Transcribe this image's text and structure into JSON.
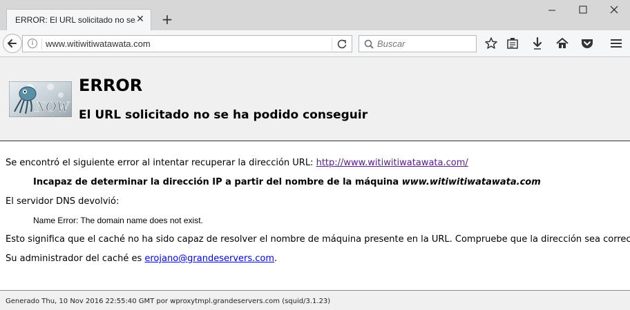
{
  "browser": {
    "tab_title": "ERROR: El URL solicitado no se...",
    "url": "www.witiwitiwatawata.com",
    "search_placeholder": "Buscar",
    "icons": [
      "close-icon",
      "plus-icon",
      "minimize-icon",
      "maximize-icon",
      "back-arrow-icon",
      "info-icon",
      "reload-icon",
      "search-icon",
      "star-icon",
      "reading-list-icon",
      "download-icon",
      "home-icon",
      "pocket-icon",
      "menu-icon"
    ]
  },
  "page": {
    "heading": "ERROR",
    "subheading": "El URL solicitado no se ha podido conseguir",
    "intro_text": "Se encontró el siguiente error al intentar recuperar la dirección URL: ",
    "intro_link": "http://www.witiwitiwatawata.com/",
    "error_bold": "Incapaz de determinar la dirección IP a partir del nombre de la máquina ",
    "error_host": "www.witiwitiwatawata.com",
    "dns_label": "El servidor DNS devolvió:",
    "dns_message": "Name Error: The domain name does not exist.",
    "meaning_text": "Esto significa que el caché no ha sido capaz de resolver el nombre de máquina presente en la URL. Compruebe que la dirección sea correcta.",
    "admin_text": "Su administrador del caché es ",
    "admin_email": "erojano@grandeservers.com",
    "admin_suffix": ".",
    "footer": "Generado Thu, 10 Nov 2016 22:55:40 GMT por wproxytmpl.grandeservers.com (squid/3.1.23)"
  },
  "colors": {
    "link_visited": "#551a8b",
    "link": "#0000ee",
    "header_bg": "#f0f0f0"
  }
}
